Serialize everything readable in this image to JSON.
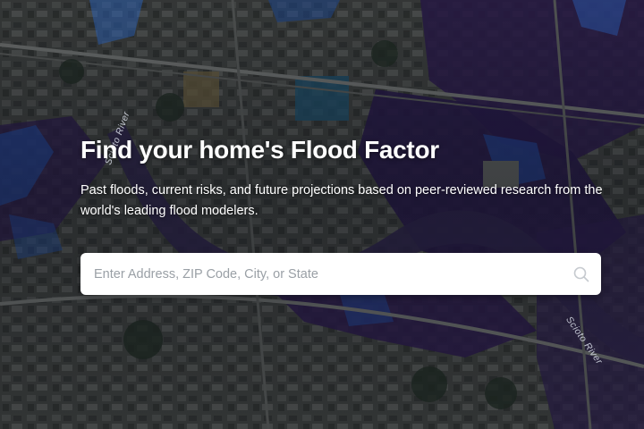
{
  "hero": {
    "title": "Find your home's Flood Factor",
    "subtitle": "Past floods, current risks, and future projections based on peer-reviewed research from the world's leading flood modelers."
  },
  "search": {
    "placeholder": "Enter Address, ZIP Code, City, or State",
    "value": "",
    "icon": "search-icon"
  },
  "map": {
    "labels": [
      "Scioto River",
      "Scioto River"
    ],
    "colors": {
      "land": "#3a3d3b",
      "flood_deep": "#2a1a4a",
      "flood_shallow": "#1e4fa8",
      "accent_blue": "#2f6fd6"
    }
  }
}
